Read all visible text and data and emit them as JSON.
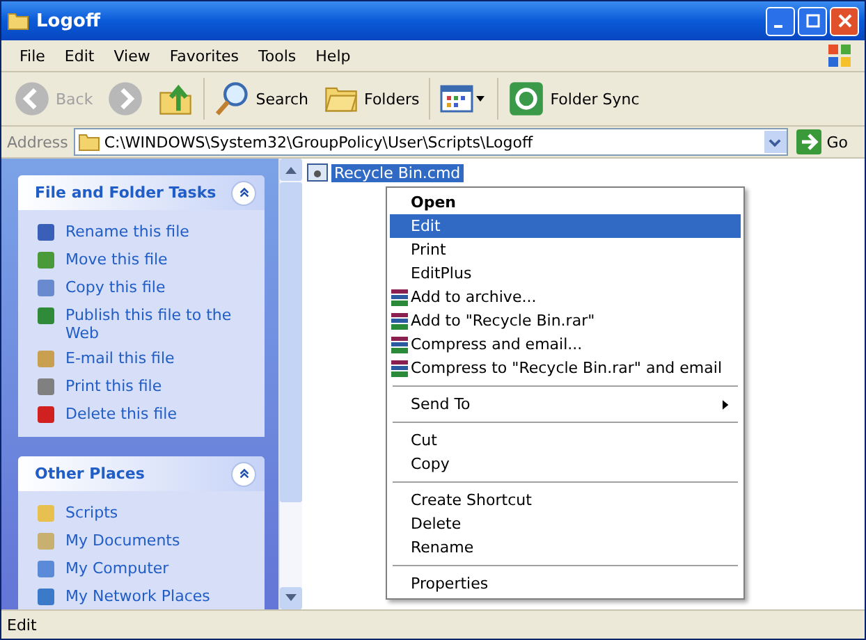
{
  "window": {
    "title": "Logoff"
  },
  "menu_bar": [
    "File",
    "Edit",
    "View",
    "Favorites",
    "Tools",
    "Help"
  ],
  "toolbar": [
    {
      "kind": "back",
      "label": "Back",
      "disabled": true
    },
    {
      "kind": "forward",
      "disabled": true
    },
    {
      "kind": "up",
      "disabled": false
    },
    {
      "kind": "search",
      "label": "Search",
      "disabled": false
    },
    {
      "kind": "folders",
      "label": "Folders",
      "disabled": false
    },
    {
      "kind": "views",
      "disabled": false
    },
    {
      "kind": "sync",
      "label": "Folder Sync",
      "disabled": false
    }
  ],
  "address_bar": {
    "label": "Address",
    "value": "C:\\WINDOWS\\System32\\GroupPolicy\\User\\Scripts\\Logoff",
    "go": "Go"
  },
  "sidebar": {
    "panels": [
      {
        "title": "File and Folder Tasks",
        "items": [
          "Rename this file",
          "Move this file",
          "Copy this file",
          "Publish this file to the Web",
          "E-mail this file",
          "Print this file",
          "Delete this file"
        ]
      },
      {
        "title": "Other Places",
        "items": [
          "Scripts",
          "My Documents",
          "My Computer",
          "My Network Places"
        ]
      }
    ]
  },
  "files": [
    {
      "name": "Recycle Bin.cmd",
      "selected": true
    }
  ],
  "context_menu": [
    {
      "kind": "item",
      "label": "Open",
      "default": true,
      "selected": false,
      "rar": false,
      "submenu": false
    },
    {
      "kind": "item",
      "label": "Edit",
      "default": false,
      "selected": true,
      "rar": false,
      "submenu": false
    },
    {
      "kind": "item",
      "label": "Print",
      "default": false,
      "selected": false,
      "rar": false,
      "submenu": false
    },
    {
      "kind": "item",
      "label": "EditPlus",
      "default": false,
      "selected": false,
      "rar": false,
      "submenu": false
    },
    {
      "kind": "item",
      "label": "Add to archive...",
      "default": false,
      "selected": false,
      "rar": true,
      "submenu": false
    },
    {
      "kind": "item",
      "label": "Add to \"Recycle Bin.rar\"",
      "default": false,
      "selected": false,
      "rar": true,
      "submenu": false
    },
    {
      "kind": "item",
      "label": "Compress and email...",
      "default": false,
      "selected": false,
      "rar": true,
      "submenu": false
    },
    {
      "kind": "item",
      "label": "Compress to \"Recycle Bin.rar\" and email",
      "default": false,
      "selected": false,
      "rar": true,
      "submenu": false
    },
    {
      "kind": "separator"
    },
    {
      "kind": "item",
      "label": "Send To",
      "default": false,
      "selected": false,
      "rar": false,
      "submenu": true
    },
    {
      "kind": "separator"
    },
    {
      "kind": "item",
      "label": "Cut",
      "default": false,
      "selected": false,
      "rar": false,
      "submenu": false
    },
    {
      "kind": "item",
      "label": "Copy",
      "default": false,
      "selected": false,
      "rar": false,
      "submenu": false
    },
    {
      "kind": "separator"
    },
    {
      "kind": "item",
      "label": "Create Shortcut",
      "default": false,
      "selected": false,
      "rar": false,
      "submenu": false
    },
    {
      "kind": "item",
      "label": "Delete",
      "default": false,
      "selected": false,
      "rar": false,
      "submenu": false
    },
    {
      "kind": "item",
      "label": "Rename",
      "default": false,
      "selected": false,
      "rar": false,
      "submenu": false
    },
    {
      "kind": "separator"
    },
    {
      "kind": "item",
      "label": "Properties",
      "default": false,
      "selected": false,
      "rar": false,
      "submenu": false
    }
  ],
  "status_bar": {
    "text": "Edit"
  }
}
